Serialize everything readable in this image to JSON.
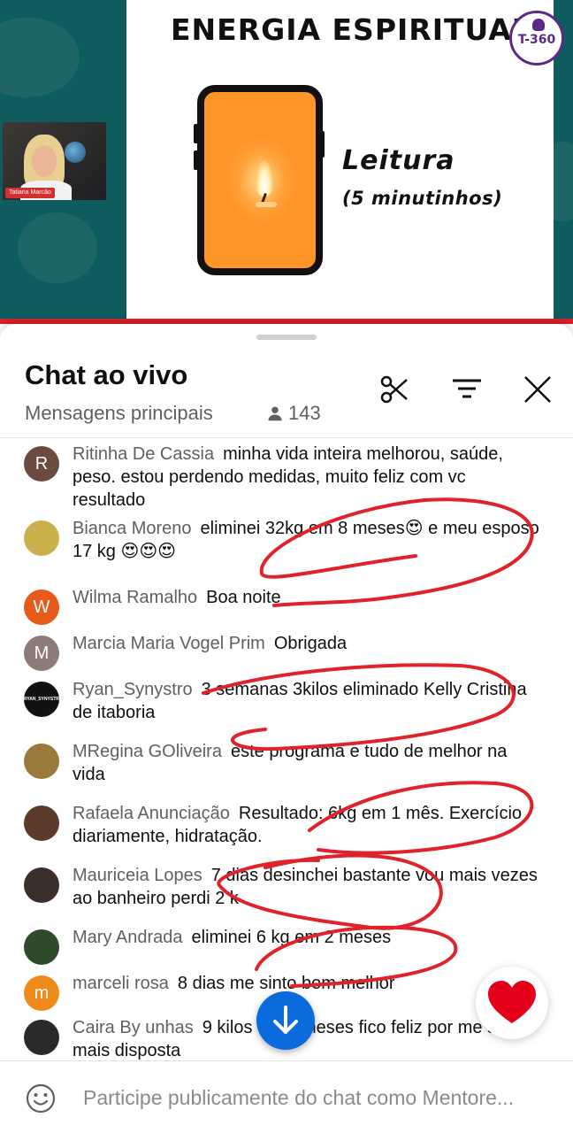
{
  "video": {
    "slide_title": "ENERGIA ESPIRITUAL",
    "logo_text": "T-360",
    "slide_heading": "Leitura",
    "slide_subheading": "(5 minutinhos)",
    "presenter_name": "Tatiana Marcão"
  },
  "chat": {
    "title": "Chat ao vivo",
    "mode": "Mensagens principais",
    "viewer_count": "143",
    "icons": [
      "scissors-icon",
      "filter-icon",
      "close-icon"
    ]
  },
  "messages": [
    {
      "author": "Ritinha De Cassia",
      "avatar_letter": "R",
      "avatar_color": "#6b4a3f",
      "text": "minha vida inteira melhorou, saúde, peso. estou perdendo medidas, muito feliz com vc resultado"
    },
    {
      "author": "Bianca Moreno",
      "avatar_letter": "",
      "avatar_color": "#c9b04a",
      "text": "eliminei 32kg em 8 meses😍 e meu esposo 17 kg 😍😍😍"
    },
    {
      "author": "Wilma Ramalho",
      "avatar_letter": "W",
      "avatar_color": "#e65a1a",
      "text": "Boa noite"
    },
    {
      "author": "Marcia Maria Vogel Prim",
      "avatar_letter": "M",
      "avatar_color": "#8d7b78",
      "text": "Obrigada"
    },
    {
      "author": "Ryan_Synystro",
      "avatar_letter": "RYAN_SYNYSTRO",
      "avatar_color": "#111111",
      "text": "3 semanas 3kilos eliminado Kelly Cristina de itaboria"
    },
    {
      "author": "MRegina GOliveira",
      "avatar_letter": "",
      "avatar_color": "#9a7a3a",
      "text": "este programa e tudo de melhor na vida"
    },
    {
      "author": "Rafaela Anunciação",
      "avatar_letter": "",
      "avatar_color": "#5a3a2a",
      "text": "Resultado: 6kg em 1 mês. Exercício diariamente, hidratação."
    },
    {
      "author": "Mauriceia Lopes",
      "avatar_letter": "",
      "avatar_color": "#3a2f2a",
      "text": "7 dias desinchei bastante vou mais vezes ao banheiro perdi 2 k"
    },
    {
      "author": "Mary Andrada",
      "avatar_letter": "",
      "avatar_color": "#2f4a2a",
      "text": "eliminei 6 kg em 2 meses"
    },
    {
      "author": "marceli rosa",
      "avatar_letter": "m",
      "avatar_color": "#ef8a1a",
      "text": "8 dias me sinto bem melhor"
    },
    {
      "author": "Caira By unhas",
      "avatar_letter": "",
      "avatar_color": "#2a2a2a",
      "text": "9 kilos em 3 meses fico feliz por me sentir mais disposta"
    }
  ],
  "composer": {
    "placeholder": "Participe publicamente do chat como Mentore..."
  },
  "colors": {
    "accent": "#0b6bdc",
    "heart": "#e4001b",
    "annotation": "#e0232b",
    "video_bg": "#0f5c5e"
  }
}
